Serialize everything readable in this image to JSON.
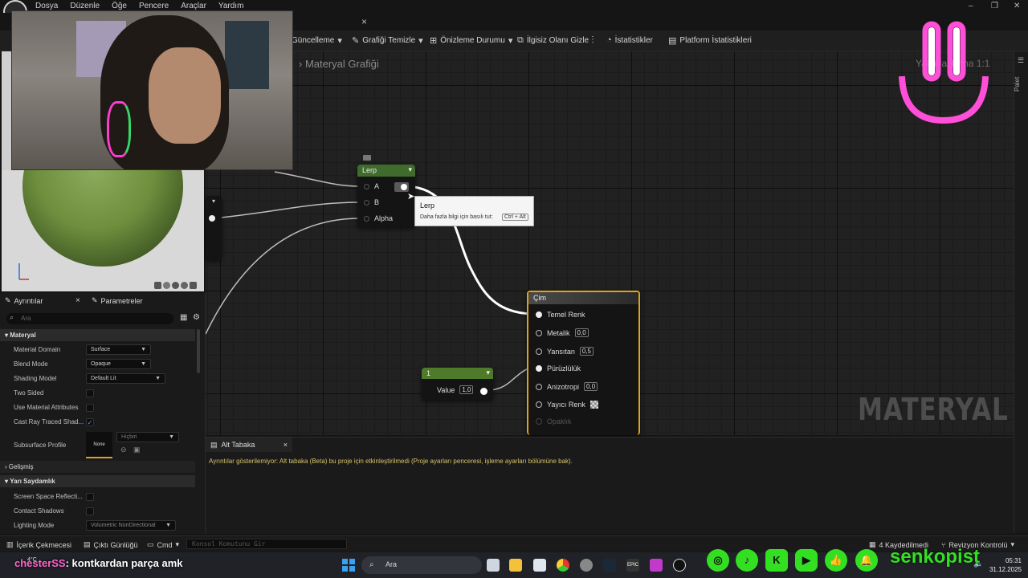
{
  "menu": {
    "items": [
      "Dosya",
      "Düzenle",
      "Öğe",
      "Pencere",
      "Araçlar",
      "Yardım"
    ]
  },
  "window_controls": {
    "minimize": "–",
    "restore": "❐",
    "close": "✕"
  },
  "tab": {
    "close_glyph": "×"
  },
  "toolbar": {
    "update_label": "Güncelleme",
    "clean_graph_label": "Grafiği Temizle",
    "preview_state_label": "Önizleme Durumu",
    "hide_unrelated_label": "İlgisiz Olanı Gizle",
    "stats_label": "İstatistikler",
    "platform_stats_label": "Platform İstatistikleri"
  },
  "graph": {
    "breadcrumb": "Materyal Grafiği",
    "zoom_label": "Yakınlaştırma 1:1",
    "palette_label": "Palet",
    "lerp_node": {
      "title": "Lerp",
      "pins": [
        "A",
        "B",
        "Alpha"
      ]
    },
    "tooltip": {
      "title": "Lerp",
      "hint": "Daha fazla bilgi için basılı tut:",
      "shortcut": "Ctrl + Alt"
    },
    "constant_node": {
      "title": "1",
      "value_label": "Value",
      "value": "1,0"
    },
    "material_node": {
      "title": "Çim",
      "pins": [
        {
          "label": "Temel Renk",
          "value": ""
        },
        {
          "label": "Metalik",
          "value": "0,0"
        },
        {
          "label": "Yansıtan",
          "value": "0,5"
        },
        {
          "label": "Pürüzlülük",
          "value": ""
        },
        {
          "label": "Anizotropi",
          "value": "0,0"
        },
        {
          "label": "Yayıcı Renk",
          "value": ""
        },
        {
          "label": "Opaklık",
          "value": ""
        }
      ]
    },
    "watermark": "MATERYAL"
  },
  "details": {
    "tab_details": "Ayrıntılar",
    "tab_params": "Parametreler",
    "search_placeholder": "Ara",
    "section_material": "Materyal",
    "props": [
      {
        "label": "Material Domain",
        "value": "Surface"
      },
      {
        "label": "Blend Mode",
        "value": "Opaque"
      },
      {
        "label": "Shading Model",
        "value": "Default Lit"
      },
      {
        "label": "Two Sided",
        "checked": false
      },
      {
        "label": "Use Material Attributes",
        "checked": false
      },
      {
        "label": "Cast Ray Traced Shad...",
        "checked": true
      }
    ],
    "subsurface_label": "Subsurface Profile",
    "subsurface_thumb": "None",
    "subsurface_value": "Hiçbiri",
    "section_advanced": "Gelişmiş",
    "section_translucency": "Yarı Saydamlık",
    "translucency_props": [
      {
        "label": "Screen Space Reflecti...",
        "checked": false
      },
      {
        "label": "Contact Shadows",
        "checked": false
      }
    ],
    "lighting_mode_label": "Lighting Mode",
    "lighting_mode_value": "Volumetric NonDirectional"
  },
  "substrate": {
    "tab": "Alt Tabaka",
    "message": "Ayrıntılar gösterilemiyor: Alt tabaka (Beta) bu proje için etkinleştirilmedi (Proje ayarları penceresi, işleme ayarları bölümüne bak)."
  },
  "statusbar": {
    "content_drawer": "İçerik Çekmecesi",
    "output_log": "Çıktı Günlüğü",
    "cmd": "Cmd",
    "console_placeholder": "Konsol Komutunu Gir",
    "saved": "4 Kaydedilmedi",
    "revision": "Revizyon Kontrolü"
  },
  "taskbar": {
    "search": "Ara",
    "time": "05:31",
    "date": "31.12.2025",
    "weather": "4°C"
  },
  "overlay": {
    "chat_nick": "chesterSS",
    "chat_message": ": kontkardan parça amk",
    "social_handle": "senkopist"
  },
  "colors": {
    "lerp_header": "#3f6b2c",
    "constant_header": "#4f7a2a",
    "material_border": "#e0a020",
    "accent_pink": "#ff4fd8",
    "social_green": "#33e021"
  }
}
